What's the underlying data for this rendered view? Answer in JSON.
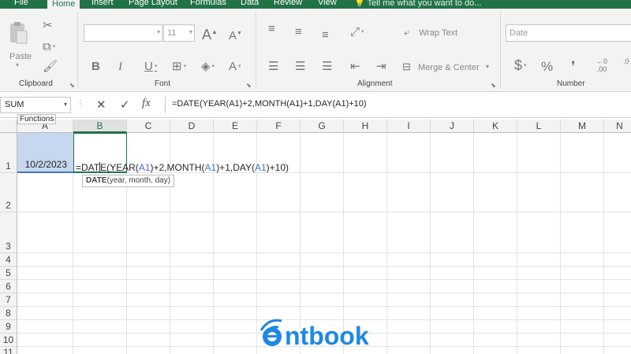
{
  "ribbon_tabs": [
    "File",
    "Home",
    "Insert",
    "Page Layout",
    "Formulas",
    "Data",
    "Review",
    "View"
  ],
  "tell_me": "Tell me what you want to do...",
  "clipboard": {
    "paste_label": "Paste",
    "group_label": "Clipboard"
  },
  "font": {
    "name_value": "",
    "size_value": "11",
    "group_label": "Font"
  },
  "alignment": {
    "wrap_text": "Wrap Text",
    "merge_center": "Merge & Center",
    "group_label": "Alignment"
  },
  "number": {
    "format_value": "Date",
    "currency_symbol": "$",
    "percent_symbol": "%",
    "comma_symbol": "❜",
    "group_label": "Number"
  },
  "formula_bar": {
    "name_box": "SUM",
    "fx": "fx",
    "content": "=DATE(YEAR(A1)+2,MONTH(A1)+1,DAY(A1)+10)"
  },
  "tooltip_functions": "Functions",
  "columns": [
    "A",
    "B",
    "C",
    "D",
    "E",
    "F",
    "G",
    "H",
    "I",
    "J",
    "K",
    "L",
    "M",
    "N"
  ],
  "rows": [
    "1",
    "2",
    "3",
    "4",
    "5",
    "6",
    "7",
    "8",
    "9",
    "10",
    "11"
  ],
  "cells": {
    "A1": "10/2/2023",
    "B1_parts": [
      "=DAT",
      "E(YEAR(",
      "A1",
      ")+2,MONTH(",
      "A1",
      ")+1,DAY(",
      "A1",
      ")+10)"
    ]
  },
  "arg_tooltip": {
    "fn": "DATE",
    "args": "(year, month, day)"
  },
  "logo_text": "ntbook",
  "colors": {
    "excel_green": "#217346",
    "ref_blue": "#4472c4",
    "selection_fill": "#c6d7ef",
    "logo_blue": "#1e88e5"
  }
}
